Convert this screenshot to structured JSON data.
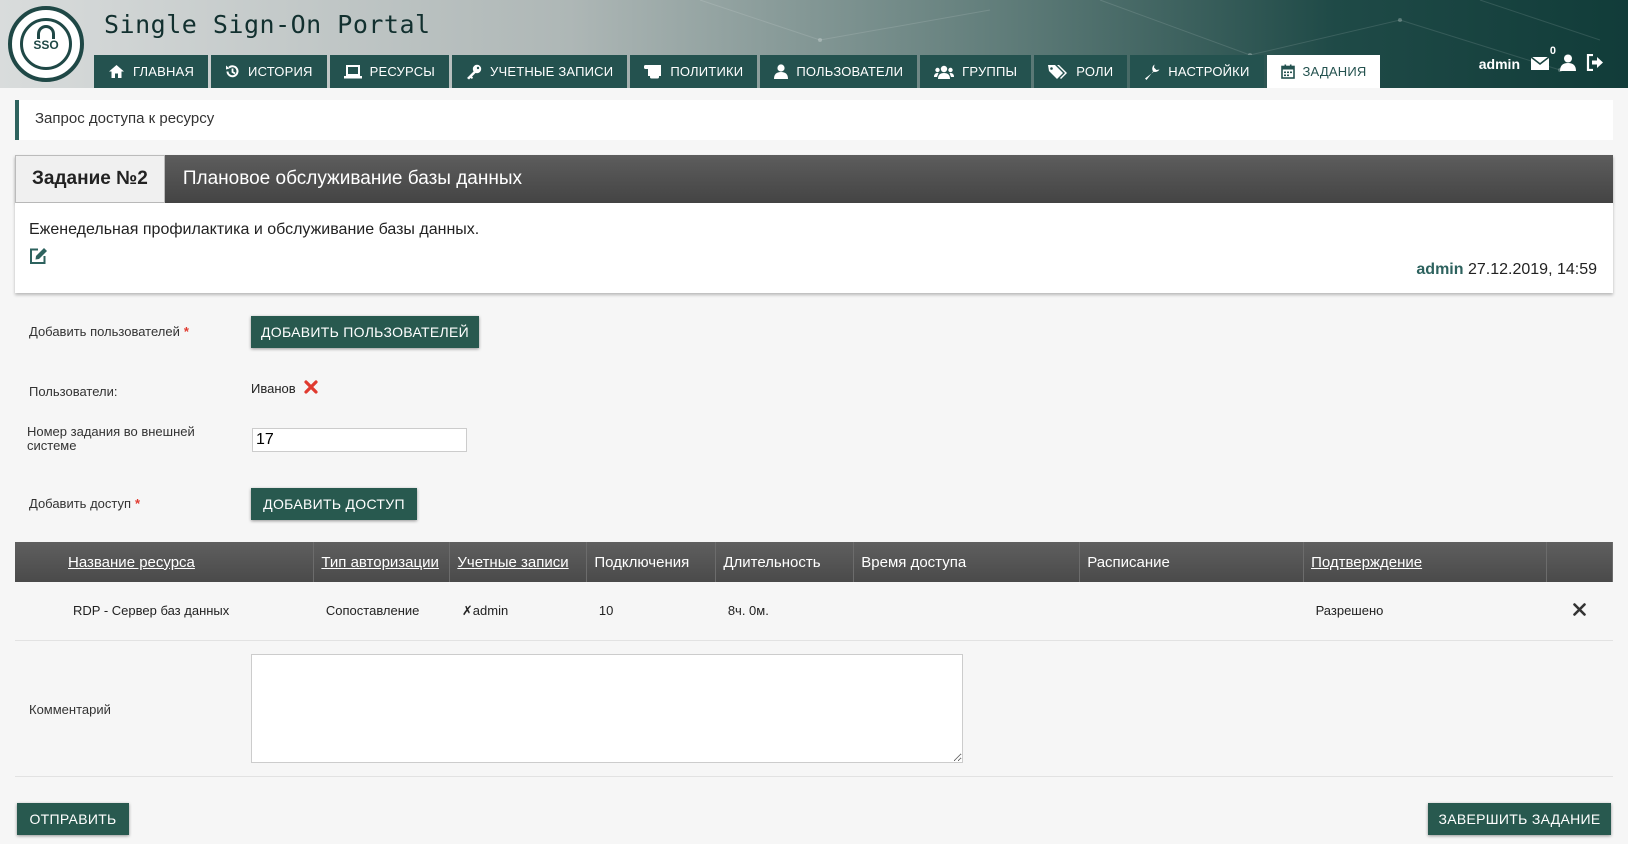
{
  "header": {
    "title": "Single Sign-On Portal",
    "logo_text": "SSO",
    "tabs": [
      {
        "label": "ГЛАВНАЯ",
        "icon": "home-icon"
      },
      {
        "label": "ИСТОРИЯ",
        "icon": "history-icon"
      },
      {
        "label": "РЕСУРСЫ",
        "icon": "laptop-icon"
      },
      {
        "label": "УЧЕТНЫЕ ЗАПИСИ",
        "icon": "key-icon"
      },
      {
        "label": "ПОЛИТИКИ",
        "icon": "scroll-icon"
      },
      {
        "label": "ПОЛЬЗОВАТЕЛИ",
        "icon": "user-icon"
      },
      {
        "label": "ГРУППЫ",
        "icon": "users-icon"
      },
      {
        "label": "РОЛИ",
        "icon": "tags-icon"
      },
      {
        "label": "НАСТРОЙКИ",
        "icon": "wrench-icon"
      },
      {
        "label": "ЗАДАНИЯ",
        "icon": "calendar-icon",
        "active": true
      }
    ],
    "user": {
      "name": "admin",
      "mail_count": "0"
    }
  },
  "breadcrumb": "Запрос доступа к ресурсу",
  "task": {
    "number": "Задание №2",
    "name": "Плановое обслуживание базы данных",
    "description": "Еженедельная профилактика и обслуживание базы данных.",
    "author": "admin",
    "datetime": "27.12.2019, 14:59"
  },
  "form": {
    "add_users_label": "Добавить пользователей",
    "add_users_button": "ДОБАВИТЬ ПОЛЬЗОВАТЕЛЕЙ",
    "users_label": "Пользователи:",
    "users": [
      "Иванов"
    ],
    "ext_number_label_1": "Номер задания во внешней",
    "ext_number_label_2": "системе",
    "ext_number_value": "17",
    "add_access_label": "Добавить доступ",
    "add_access_button": "ДОБАВИТЬ ДОСТУП",
    "comment_label": "Комментарий",
    "comment_value": "",
    "submit_button": "ОТПРАВИТЬ",
    "finish_button": "ЗАВЕРШИТЬ ЗАДАНИЕ"
  },
  "table": {
    "headers": [
      "Название ресурса",
      "Тип авторизации",
      "Учетные записи",
      "Подключения",
      "Длительность",
      "Время доступа",
      "Расписание",
      "Подтверждение"
    ],
    "rows": [
      {
        "resource": "RDP - Сервер баз данных",
        "auth_type": "Сопоставление",
        "account": "admin",
        "connections": "10",
        "duration": "8ч. 0м.",
        "access_time": "",
        "schedule": "",
        "approval": "Разрешено"
      }
    ]
  },
  "colors": {
    "primary": "#28594f",
    "danger": "#e03a2f"
  }
}
